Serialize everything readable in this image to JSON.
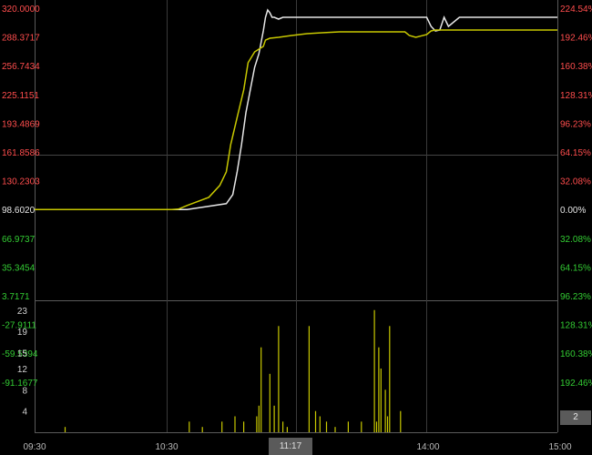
{
  "chart_data": {
    "type": "line",
    "price_axis_labels": [
      "320.0000",
      "288.3717",
      "256.7434",
      "225.1151",
      "193.4869",
      "161.8586",
      "130.2303",
      "98.6020",
      "66.9737",
      "35.3454",
      "3.7171",
      "-27.9111",
      "-59.5394",
      "-91.1677"
    ],
    "pct_axis_labels": [
      "224.54%",
      "192.46%",
      "160.38%",
      "128.31%",
      "96.23%",
      "64.15%",
      "32.08%",
      "0.00%",
      "32.08%",
      "64.15%",
      "96.23%",
      "128.31%",
      "160.38%",
      "192.46%"
    ],
    "price_ylim": [
      -122.796,
      320.0
    ],
    "x_ticks": [
      "09:30",
      "10:30",
      "11:17",
      "14:00",
      "15:00"
    ],
    "series": [
      {
        "color": "#e6e6e6",
        "x": [
          0,
          31,
          50,
          70,
          88,
          91,
          93,
          95,
          97,
          99,
          101,
          103,
          105,
          106,
          107,
          108,
          109,
          110,
          112,
          114,
          118,
          120,
          170,
          180,
          182,
          184,
          186,
          188,
          190,
          195,
          240
        ],
        "y": [
          98.6,
          98.6,
          98.6,
          98.6,
          105,
          115,
          140,
          170,
          205,
          230,
          255,
          270,
          295,
          310,
          318,
          315,
          310,
          310,
          308,
          310,
          310,
          310,
          310,
          310,
          300,
          295,
          296,
          310,
          300,
          310,
          310
        ]
      },
      {
        "color": "#c8c800",
        "x": [
          0,
          31,
          50,
          63,
          66,
          70,
          80,
          85,
          88,
          90,
          93,
          96,
          98,
          101,
          103,
          105,
          106,
          108,
          112,
          118,
          125,
          132,
          140,
          155,
          165,
          170,
          172,
          175,
          180,
          182,
          184,
          186,
          188,
          190,
          195,
          240
        ],
        "y": [
          98.6,
          98.6,
          98.6,
          98.6,
          99,
          103,
          112,
          125,
          140,
          170,
          200,
          230,
          260,
          272,
          275,
          278,
          285,
          287,
          288,
          290,
          292,
          293,
          294,
          294,
          294,
          294,
          290,
          288,
          291,
          295,
          296,
          296,
          296,
          296,
          296,
          296
        ]
      }
    ],
    "volume": {
      "labels": [
        "23",
        "19",
        "15",
        "12",
        "8",
        "4"
      ],
      "ylim": [
        0,
        24
      ],
      "bars": [
        [
          14,
          1
        ],
        [
          71,
          2
        ],
        [
          77,
          1
        ],
        [
          86,
          2
        ],
        [
          92,
          3
        ],
        [
          96,
          2
        ],
        [
          102,
          3
        ],
        [
          103,
          5
        ],
        [
          104,
          16
        ],
        [
          108,
          11
        ],
        [
          110,
          5
        ],
        [
          112,
          20
        ],
        [
          114,
          2
        ],
        [
          116,
          1
        ],
        [
          126,
          20
        ],
        [
          129,
          4
        ],
        [
          131,
          3
        ],
        [
          134,
          2
        ],
        [
          138,
          1
        ],
        [
          144,
          2
        ],
        [
          150,
          2
        ],
        [
          156,
          23
        ],
        [
          157,
          2
        ],
        [
          158,
          16
        ],
        [
          159,
          12
        ],
        [
          161,
          8
        ],
        [
          162,
          3
        ],
        [
          163,
          20
        ],
        [
          168,
          4
        ]
      ]
    },
    "volume_badge": "2",
    "cursor_time": "11:17"
  }
}
